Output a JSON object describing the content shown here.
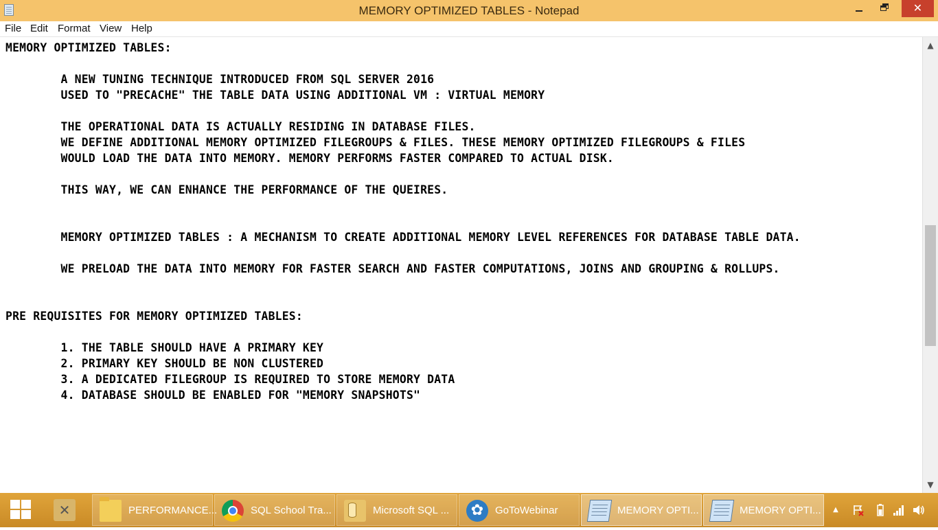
{
  "window": {
    "title": "MEMORY OPTIMIZED TABLES - Notepad",
    "close_glyph": "✕"
  },
  "menu": [
    "File",
    "Edit",
    "Format",
    "View",
    "Help"
  ],
  "document": {
    "text": "MEMORY OPTIMIZED TABLES:\n\n        A NEW TUNING TECHNIQUE INTRODUCED FROM SQL SERVER 2016\n        USED TO \"PRECACHE\" THE TABLE DATA USING ADDITIONAL VM : VIRTUAL MEMORY\n\n        THE OPERATIONAL DATA IS ACTUALLY RESIDING IN DATABASE FILES.\n        WE DEFINE ADDITIONAL MEMORY OPTIMIZED FILEGROUPS & FILES. THESE MEMORY OPTIMIZED FILEGROUPS & FILES\n        WOULD LOAD THE DATA INTO MEMORY. MEMORY PERFORMS FASTER COMPARED TO ACTUAL DISK.\n\n        THIS WAY, WE CAN ENHANCE THE PERFORMANCE OF THE QUEIRES.\n\n\n        MEMORY OPTIMIZED TABLES : A MECHANISM TO CREATE ADDITIONAL MEMORY LEVEL REFERENCES FOR DATABASE TABLE DATA.\n\n        WE PRELOAD THE DATA INTO MEMORY FOR FASTER SEARCH AND FASTER COMPUTATIONS, JOINS AND GROUPING & ROLLUPS.\n\n\nPRE REQUISITES FOR MEMORY OPTIMIZED TABLES:\n\n        1. THE TABLE SHOULD HAVE A PRIMARY KEY\n        2. PRIMARY KEY SHOULD BE NON CLUSTERED\n        3. A DEDICATED FILEGROUP IS REQUIRED TO STORE MEMORY DATA\n        4. DATABASE SHOULD BE ENABLED FOR \"MEMORY SNAPSHOTS\""
  },
  "scrollbar": {
    "up": "▲",
    "down": "▼"
  },
  "taskbar": {
    "items": [
      {
        "label": "PERFORMANCE..."
      },
      {
        "label": "SQL School Tra..."
      },
      {
        "label": "Microsoft SQL ..."
      },
      {
        "label": "GoToWebinar"
      },
      {
        "label": "MEMORY OPTI..."
      },
      {
        "label": "MEMORY OPTI..."
      }
    ],
    "tray": {
      "chevron": "▲"
    }
  },
  "colors": {
    "titlebar": "#f5c36b",
    "close": "#c7402c",
    "taskbar": "#d89a30"
  }
}
